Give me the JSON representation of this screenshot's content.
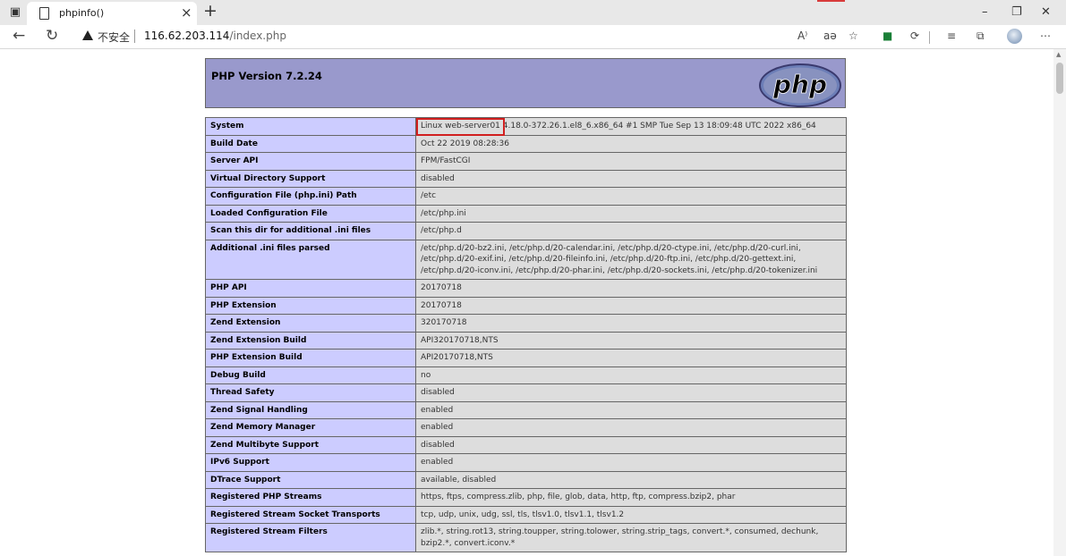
{
  "browser": {
    "tab_title": "phpinfo()",
    "security_label": "不安全",
    "url_host": "116.62.203.114",
    "url_path": "/index.php",
    "read_aloud_label": "A⁾",
    "translate_label": "aə"
  },
  "page": {
    "version_title": "PHP Version 7.2.24",
    "logo_text": "php"
  },
  "info_rows": [
    {
      "key": "System",
      "value": "Linux web-server01 4.18.0-372.26.1.el8_6.x86_64 #1 SMP Tue Sep 13 18:09:48 UTC 2022 x86_64"
    },
    {
      "key": "Build Date",
      "value": "Oct 22 2019 08:28:36"
    },
    {
      "key": "Server API",
      "value": "FPM/FastCGI"
    },
    {
      "key": "Virtual Directory Support",
      "value": "disabled"
    },
    {
      "key": "Configuration File (php.ini) Path",
      "value": "/etc"
    },
    {
      "key": "Loaded Configuration File",
      "value": "/etc/php.ini"
    },
    {
      "key": "Scan this dir for additional .ini files",
      "value": "/etc/php.d"
    },
    {
      "key": "Additional .ini files parsed",
      "value": "/etc/php.d/20-bz2.ini, /etc/php.d/20-calendar.ini, /etc/php.d/20-ctype.ini, /etc/php.d/20-curl.ini, /etc/php.d/20-exif.ini, /etc/php.d/20-fileinfo.ini, /etc/php.d/20-ftp.ini, /etc/php.d/20-gettext.ini, /etc/php.d/20-iconv.ini, /etc/php.d/20-phar.ini, /etc/php.d/20-sockets.ini, /etc/php.d/20-tokenizer.ini"
    },
    {
      "key": "PHP API",
      "value": "20170718"
    },
    {
      "key": "PHP Extension",
      "value": "20170718"
    },
    {
      "key": "Zend Extension",
      "value": "320170718"
    },
    {
      "key": "Zend Extension Build",
      "value": "API320170718,NTS"
    },
    {
      "key": "PHP Extension Build",
      "value": "API20170718,NTS"
    },
    {
      "key": "Debug Build",
      "value": "no"
    },
    {
      "key": "Thread Safety",
      "value": "disabled"
    },
    {
      "key": "Zend Signal Handling",
      "value": "enabled"
    },
    {
      "key": "Zend Memory Manager",
      "value": "enabled"
    },
    {
      "key": "Zend Multibyte Support",
      "value": "disabled"
    },
    {
      "key": "IPv6 Support",
      "value": "enabled"
    },
    {
      "key": "DTrace Support",
      "value": "available, disabled"
    },
    {
      "key": "Registered PHP Streams",
      "value": "https, ftps, compress.zlib, php, file, glob, data, http, ftp, compress.bzip2, phar"
    },
    {
      "key": "Registered Stream Socket Transports",
      "value": "tcp, udp, unix, udg, ssl, tls, tlsv1.0, tlsv1.1, tlsv1.2"
    },
    {
      "key": "Registered Stream Filters",
      "value": "zlib.*, string.rot13, string.toupper, string.tolower, string.strip_tags, convert.*, consumed, dechunk, bzip2.*, convert.iconv.*"
    }
  ],
  "colors": {
    "header_bg": "#9999cc",
    "key_cell_bg": "#ccccff",
    "value_cell_bg": "#dddddd",
    "highlight": "#d11f1f"
  }
}
